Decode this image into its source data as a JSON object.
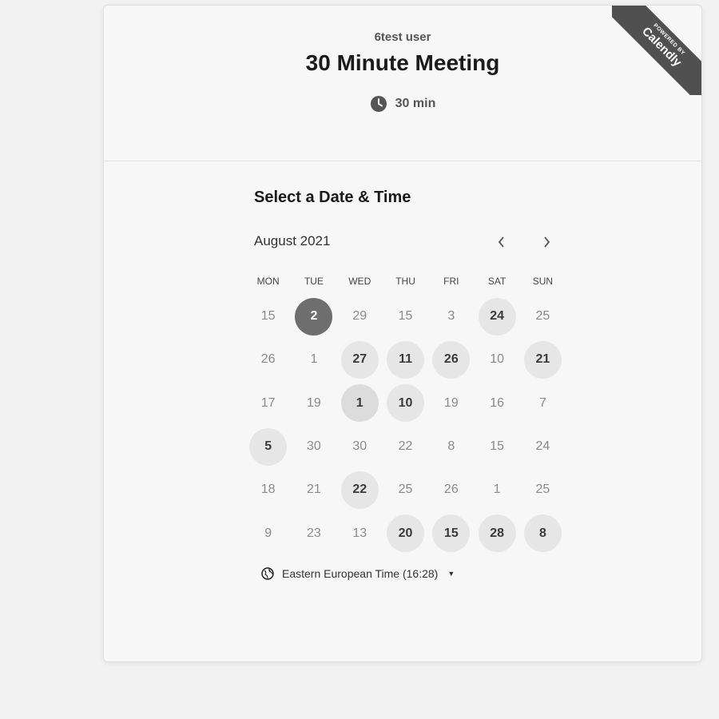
{
  "header": {
    "user_name": "6test user",
    "event_title": "30 Minute Meeting",
    "duration": "30 min",
    "badge": {
      "top": "POWERED BY",
      "brand": "Calendly"
    }
  },
  "calendar": {
    "section_title": "Select a Date & Time",
    "month_label": "August 2021",
    "weekdays": [
      "MON",
      "TUE",
      "WED",
      "THU",
      "FRI",
      "SAT",
      "SUN"
    ],
    "weeks": [
      [
        {
          "d": "15",
          "s": "off"
        },
        {
          "d": "2",
          "s": "selected"
        },
        {
          "d": "29",
          "s": "off"
        },
        {
          "d": "15",
          "s": "off"
        },
        {
          "d": "3",
          "s": "off"
        },
        {
          "d": "24",
          "s": "avail"
        },
        {
          "d": "25",
          "s": "off"
        }
      ],
      [
        {
          "d": "26",
          "s": "off"
        },
        {
          "d": "1",
          "s": "off"
        },
        {
          "d": "27",
          "s": "avail"
        },
        {
          "d": "11",
          "s": "avail"
        },
        {
          "d": "26",
          "s": "avail"
        },
        {
          "d": "10",
          "s": "off"
        },
        {
          "d": "21",
          "s": "avail"
        }
      ],
      [
        {
          "d": "17",
          "s": "off"
        },
        {
          "d": "19",
          "s": "off"
        },
        {
          "d": "1",
          "s": "hl"
        },
        {
          "d": "10",
          "s": "avail"
        },
        {
          "d": "19",
          "s": "off"
        },
        {
          "d": "16",
          "s": "off"
        },
        {
          "d": "7",
          "s": "off"
        }
      ],
      [
        {
          "d": "5",
          "s": "avail"
        },
        {
          "d": "30",
          "s": "off"
        },
        {
          "d": "30",
          "s": "off"
        },
        {
          "d": "22",
          "s": "off"
        },
        {
          "d": "8",
          "s": "off"
        },
        {
          "d": "15",
          "s": "off"
        },
        {
          "d": "24",
          "s": "off"
        }
      ],
      [
        {
          "d": "18",
          "s": "off"
        },
        {
          "d": "21",
          "s": "off"
        },
        {
          "d": "22",
          "s": "avail"
        },
        {
          "d": "25",
          "s": "off"
        },
        {
          "d": "26",
          "s": "off"
        },
        {
          "d": "1",
          "s": "off"
        },
        {
          "d": "25",
          "s": "off"
        }
      ],
      [
        {
          "d": "9",
          "s": "off"
        },
        {
          "d": "23",
          "s": "off"
        },
        {
          "d": "13",
          "s": "off"
        },
        {
          "d": "20",
          "s": "avail"
        },
        {
          "d": "15",
          "s": "avail"
        },
        {
          "d": "28",
          "s": "avail"
        },
        {
          "d": "8",
          "s": "avail"
        }
      ]
    ]
  },
  "timezone": {
    "label": "Eastern European Time (16:28)"
  },
  "icons": {
    "clock": "clock-icon",
    "globe": "globe-icon",
    "prev": "chevron-left-icon",
    "next": "chevron-right-icon",
    "caret": "caret-down-icon"
  }
}
